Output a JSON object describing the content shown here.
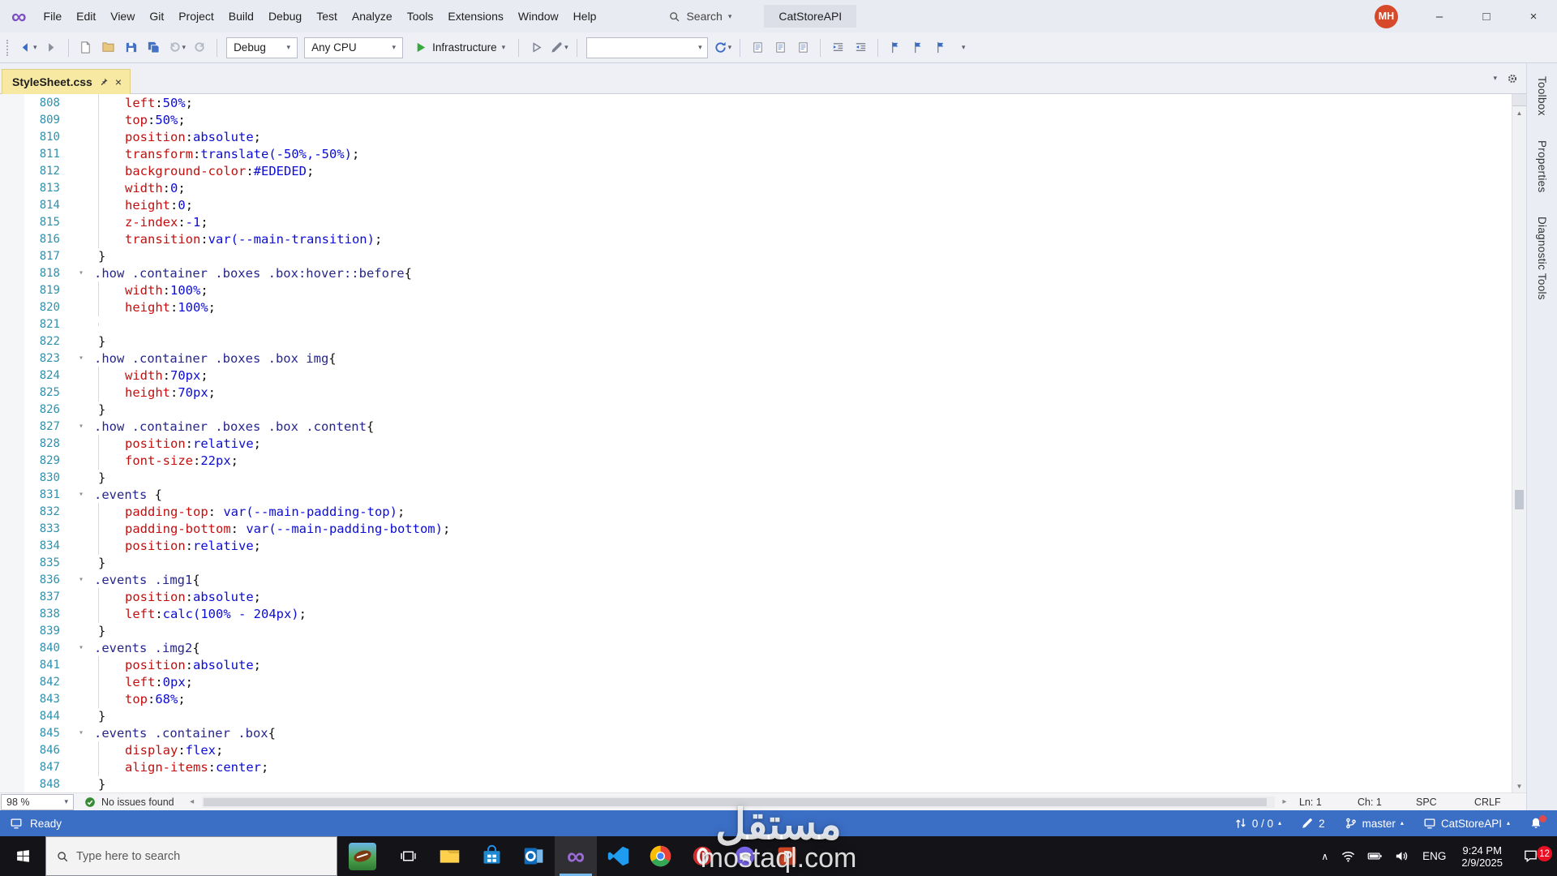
{
  "window": {
    "menus": [
      "File",
      "Edit",
      "View",
      "Git",
      "Project",
      "Build",
      "Debug",
      "Test",
      "Analyze",
      "Tools",
      "Extensions",
      "Window",
      "Help"
    ],
    "search_label": "Search",
    "solution_name": "CatStoreAPI",
    "avatar_initials": "MH"
  },
  "toolbar": {
    "debug_config": "Debug",
    "platform": "Any CPU",
    "run_label": "Infrastructure"
  },
  "tab": {
    "title": "StyleSheet.css"
  },
  "editor": {
    "lines": [
      {
        "n": 808,
        "i": 1,
        "t": [
          [
            "p",
            "left"
          ],
          [
            "x",
            ":"
          ],
          [
            "v",
            "50%"
          ],
          [
            "x",
            ";"
          ]
        ]
      },
      {
        "n": 809,
        "i": 1,
        "t": [
          [
            "p",
            "top"
          ],
          [
            "x",
            ":"
          ],
          [
            "v",
            "50%"
          ],
          [
            "x",
            ";"
          ]
        ]
      },
      {
        "n": 810,
        "i": 1,
        "t": [
          [
            "p",
            "position"
          ],
          [
            "x",
            ":"
          ],
          [
            "v",
            "absolute"
          ],
          [
            "x",
            ";"
          ]
        ]
      },
      {
        "n": 811,
        "i": 1,
        "t": [
          [
            "p",
            "transform"
          ],
          [
            "x",
            ":"
          ],
          [
            "v",
            "translate(-50%,-50%)"
          ],
          [
            "x",
            ";"
          ]
        ]
      },
      {
        "n": 812,
        "i": 1,
        "t": [
          [
            "p",
            "background-color"
          ],
          [
            "x",
            ":"
          ],
          [
            "v",
            "#EDEDED"
          ],
          [
            "x",
            ";"
          ]
        ]
      },
      {
        "n": 813,
        "i": 1,
        "t": [
          [
            "p",
            "width"
          ],
          [
            "x",
            ":"
          ],
          [
            "v",
            "0"
          ],
          [
            "x",
            ";"
          ]
        ]
      },
      {
        "n": 814,
        "i": 1,
        "t": [
          [
            "p",
            "height"
          ],
          [
            "x",
            ":"
          ],
          [
            "v",
            "0"
          ],
          [
            "x",
            ";"
          ]
        ]
      },
      {
        "n": 815,
        "i": 1,
        "t": [
          [
            "p",
            "z-index"
          ],
          [
            "x",
            ":"
          ],
          [
            "v",
            "-1"
          ],
          [
            "x",
            ";"
          ]
        ]
      },
      {
        "n": 816,
        "i": 1,
        "t": [
          [
            "p",
            "transition"
          ],
          [
            "x",
            ":"
          ],
          [
            "v",
            "var(--main-transition)"
          ],
          [
            "x",
            ";"
          ]
        ]
      },
      {
        "n": 817,
        "t": [
          [
            "x",
            "}"
          ]
        ]
      },
      {
        "n": 818,
        "f": 1,
        "t": [
          [
            "s",
            ".how .container .boxes .box:hover::before"
          ],
          [
            "x",
            "{"
          ]
        ]
      },
      {
        "n": 819,
        "i": 1,
        "t": [
          [
            "p",
            "width"
          ],
          [
            "x",
            ":"
          ],
          [
            "v",
            "100%"
          ],
          [
            "x",
            ";"
          ]
        ]
      },
      {
        "n": 820,
        "i": 1,
        "t": [
          [
            "p",
            "height"
          ],
          [
            "x",
            ":"
          ],
          [
            "v",
            "100%"
          ],
          [
            "x",
            ";"
          ]
        ]
      },
      {
        "n": 821,
        "i": 1,
        "t": []
      },
      {
        "n": 822,
        "t": [
          [
            "x",
            "}"
          ]
        ]
      },
      {
        "n": 823,
        "f": 1,
        "t": [
          [
            "s",
            ".how .container .boxes .box img"
          ],
          [
            "x",
            "{"
          ]
        ]
      },
      {
        "n": 824,
        "i": 1,
        "t": [
          [
            "p",
            "width"
          ],
          [
            "x",
            ":"
          ],
          [
            "v",
            "70px"
          ],
          [
            "x",
            ";"
          ]
        ]
      },
      {
        "n": 825,
        "i": 1,
        "t": [
          [
            "p",
            "height"
          ],
          [
            "x",
            ":"
          ],
          [
            "v",
            "70px"
          ],
          [
            "x",
            ";"
          ]
        ]
      },
      {
        "n": 826,
        "t": [
          [
            "x",
            "}"
          ]
        ]
      },
      {
        "n": 827,
        "f": 1,
        "t": [
          [
            "s",
            ".how .container .boxes .box .content"
          ],
          [
            "x",
            "{"
          ]
        ]
      },
      {
        "n": 828,
        "i": 1,
        "t": [
          [
            "p",
            "position"
          ],
          [
            "x",
            ":"
          ],
          [
            "v",
            "relative"
          ],
          [
            "x",
            ";"
          ]
        ]
      },
      {
        "n": 829,
        "i": 1,
        "t": [
          [
            "p",
            "font-size"
          ],
          [
            "x",
            ":"
          ],
          [
            "v",
            "22px"
          ],
          [
            "x",
            ";"
          ]
        ]
      },
      {
        "n": 830,
        "t": [
          [
            "x",
            "}"
          ]
        ]
      },
      {
        "n": 831,
        "f": 1,
        "t": [
          [
            "s",
            ".events "
          ],
          [
            "x",
            "{"
          ]
        ]
      },
      {
        "n": 832,
        "i": 1,
        "t": [
          [
            "p",
            "padding-top"
          ],
          [
            "x",
            ": "
          ],
          [
            "v",
            "var(--main-padding-top)"
          ],
          [
            "x",
            ";"
          ]
        ]
      },
      {
        "n": 833,
        "i": 1,
        "t": [
          [
            "p",
            "padding-bottom"
          ],
          [
            "x",
            ": "
          ],
          [
            "v",
            "var(--main-padding-bottom)"
          ],
          [
            "x",
            ";"
          ]
        ]
      },
      {
        "n": 834,
        "i": 1,
        "t": [
          [
            "p",
            "position"
          ],
          [
            "x",
            ":"
          ],
          [
            "v",
            "relative"
          ],
          [
            "x",
            ";"
          ]
        ]
      },
      {
        "n": 835,
        "t": [
          [
            "x",
            "}"
          ]
        ]
      },
      {
        "n": 836,
        "f": 1,
        "t": [
          [
            "s",
            ".events .img1"
          ],
          [
            "x",
            "{"
          ]
        ]
      },
      {
        "n": 837,
        "i": 1,
        "t": [
          [
            "p",
            "position"
          ],
          [
            "x",
            ":"
          ],
          [
            "v",
            "absolute"
          ],
          [
            "x",
            ";"
          ]
        ]
      },
      {
        "n": 838,
        "i": 1,
        "t": [
          [
            "p",
            "left"
          ],
          [
            "x",
            ":"
          ],
          [
            "v",
            "calc(100% - 204px)"
          ],
          [
            "x",
            ";"
          ]
        ]
      },
      {
        "n": 839,
        "t": [
          [
            "x",
            "}"
          ]
        ]
      },
      {
        "n": 840,
        "f": 1,
        "t": [
          [
            "s",
            ".events .img2"
          ],
          [
            "x",
            "{"
          ]
        ]
      },
      {
        "n": 841,
        "i": 1,
        "t": [
          [
            "p",
            "position"
          ],
          [
            "x",
            ":"
          ],
          [
            "v",
            "absolute"
          ],
          [
            "x",
            ";"
          ]
        ]
      },
      {
        "n": 842,
        "i": 1,
        "t": [
          [
            "p",
            "left"
          ],
          [
            "x",
            ":"
          ],
          [
            "v",
            "0px"
          ],
          [
            "x",
            ";"
          ]
        ]
      },
      {
        "n": 843,
        "i": 1,
        "t": [
          [
            "p",
            "top"
          ],
          [
            "x",
            ":"
          ],
          [
            "v",
            "68%"
          ],
          [
            "x",
            ";"
          ]
        ]
      },
      {
        "n": 844,
        "t": [
          [
            "x",
            "}"
          ]
        ]
      },
      {
        "n": 845,
        "f": 1,
        "t": [
          [
            "s",
            ".events .container .box"
          ],
          [
            "x",
            "{"
          ]
        ]
      },
      {
        "n": 846,
        "i": 1,
        "t": [
          [
            "p",
            "display"
          ],
          [
            "x",
            ":"
          ],
          [
            "v",
            "flex"
          ],
          [
            "x",
            ";"
          ]
        ]
      },
      {
        "n": 847,
        "i": 1,
        "t": [
          [
            "p",
            "align-items"
          ],
          [
            "x",
            ":"
          ],
          [
            "v",
            "center"
          ],
          [
            "x",
            ";"
          ]
        ]
      },
      {
        "n": 848,
        "t": [
          [
            "x",
            "}"
          ]
        ]
      }
    ]
  },
  "editor_status": {
    "zoom": "98 %",
    "message": "No issues found",
    "ln": "Ln: 1",
    "ch": "Ch: 1",
    "spc": "SPC",
    "eol": "CRLF"
  },
  "side_tabs": [
    "Toolbox",
    "Properties",
    "Diagnostic Tools"
  ],
  "status_bar": {
    "ready": "Ready",
    "sync_count": "0 / 0",
    "edit_count": "2",
    "branch": "master",
    "repo": "CatStoreAPI"
  },
  "taskbar": {
    "search_placeholder": "Type here to search",
    "lang": "ENG",
    "time": "9:24 PM",
    "date": "2/9/2025",
    "badge": "12"
  },
  "watermark": {
    "line1": "مستقل",
    "line2": "mostaql.com"
  },
  "icons": {
    "caret_down": "▾",
    "caret_up": "▴",
    "fold": "▾",
    "close": "×",
    "minimize": "–",
    "maximize": "□",
    "infinity": "∞",
    "chevron_up": "∧",
    "left_arrow": "◂",
    "right_arrow": "▸",
    "up_arrow": "▲",
    "down_arrow": "▼"
  },
  "colors": {
    "status_bar": "#3B6EC5",
    "active_tab": "#F8E9A2",
    "line_number": "#2B91AF",
    "css_property": "#C40E0E",
    "css_value": "#0B0BD6",
    "css_selector": "#26268B"
  }
}
